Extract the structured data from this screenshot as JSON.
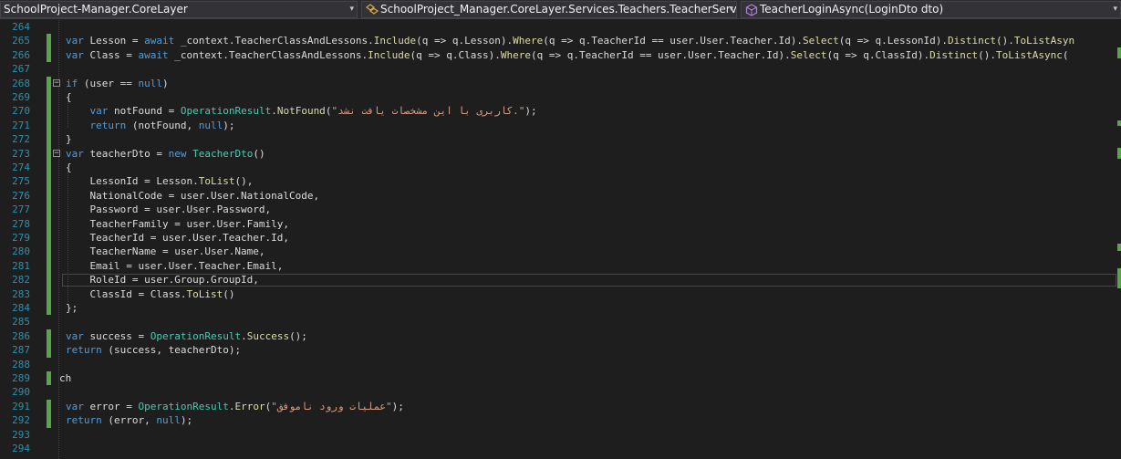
{
  "navbar": {
    "project_combo": "SchoolProject-Manager.CoreLayer",
    "class_combo": "SchoolProject_Manager.CoreLayer.Services.Teachers.TeacherService",
    "member_combo": "TeacherLoginAsync(LoginDto dto)",
    "dropdown_arrow": "▾"
  },
  "editor": {
    "lines": [
      {
        "n": "264",
        "t": ""
      },
      {
        "n": "265",
        "t": "var Lesson = await _context.TeacherClassAndLessons.Include(q => q.Lesson).Where(q => q.TeacherId == user.User.Teacher.Id).Select(q => q.LessonId).Distinct().ToListAsyn"
      },
      {
        "n": "266",
        "t": "var Class = await _context.TeacherClassAndLessons.Include(q => q.Class).Where(q => q.TeacherId == user.User.Teacher.Id).Select(q => q.ClassId).Distinct().ToListAsync("
      },
      {
        "n": "267",
        "t": ""
      },
      {
        "n": "268",
        "t": "if (user == null)"
      },
      {
        "n": "269",
        "t": "{"
      },
      {
        "n": "270",
        "t": "    var notFound = OperationResult.NotFound(\"کاربری با این مشخصات یافت نشد.\");"
      },
      {
        "n": "271",
        "t": "    return (notFound, null);"
      },
      {
        "n": "272",
        "t": "}"
      },
      {
        "n": "273",
        "t": "var teacherDto = new TeacherDto()"
      },
      {
        "n": "274",
        "t": "{"
      },
      {
        "n": "275",
        "t": "    LessonId = Lesson.ToList(),"
      },
      {
        "n": "276",
        "t": "    NationalCode = user.User.NationalCode,"
      },
      {
        "n": "277",
        "t": "    Password = user.User.Password,"
      },
      {
        "n": "278",
        "t": "    TeacherFamily = user.User.Family,"
      },
      {
        "n": "279",
        "t": "    TeacherId = user.User.Teacher.Id,"
      },
      {
        "n": "280",
        "t": "    TeacherName = user.User.Name,"
      },
      {
        "n": "281",
        "t": "    Email = user.User.Teacher.Email,"
      },
      {
        "n": "282",
        "t": "    RoleId = user.Group.GroupId,"
      },
      {
        "n": "283",
        "t": "    ClassId = Class.ToList()"
      },
      {
        "n": "284",
        "t": "};"
      },
      {
        "n": "285",
        "t": ""
      },
      {
        "n": "286",
        "t": "var success = OperationResult.Success();"
      },
      {
        "n": "287",
        "t": "return (success, teacherDto);"
      },
      {
        "n": "288",
        "t": ""
      },
      {
        "n": "289",
        "t": "ch"
      },
      {
        "n": "290",
        "t": ""
      },
      {
        "n": "291",
        "t": "var error = OperationResult.Error(\"عملیات ورود ناموفق\");"
      },
      {
        "n": "292",
        "t": "return (error, null);"
      },
      {
        "n": "293",
        "t": ""
      },
      {
        "n": "294",
        "t": ""
      }
    ],
    "fold_symbol": "−"
  },
  "colors": {
    "background": "#1e1e1e",
    "line_number": "#2b91af",
    "keyword": "#569cd6",
    "type": "#4ec9b0",
    "method": "#dcdcaa",
    "string": "#d69d85",
    "change_marker": "#57a64a"
  }
}
